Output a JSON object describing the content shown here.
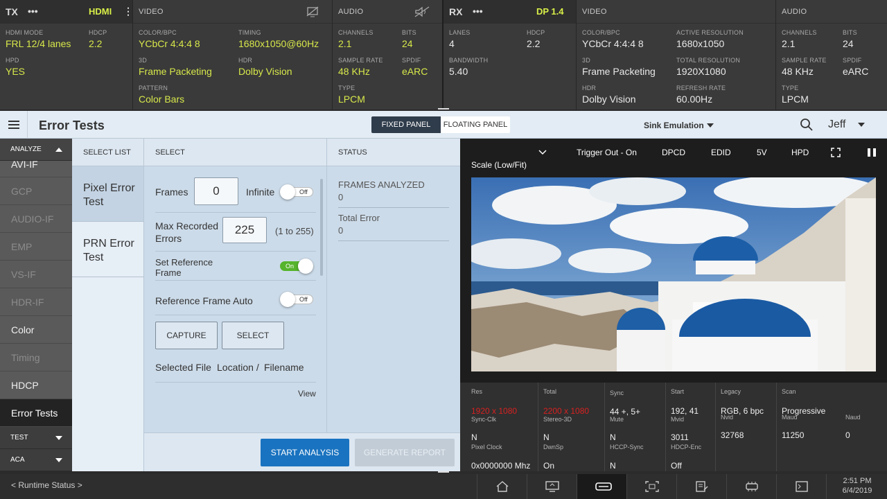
{
  "tx": {
    "label": "TX",
    "mode": "HDMI",
    "hdmi_mode_label": "HDMI MODE",
    "hdmi_mode": "FRL 12/4 lanes",
    "hdcp_label": "HDCP",
    "hdcp": "2.2",
    "hpd_label": "HPD",
    "hpd": "YES",
    "video": {
      "title": "VIDEO",
      "color_label": "COLOR/BPC",
      "color": "YCbCr  4:4:4  8",
      "timing_label": "TIMING",
      "timing": "1680x1050@60Hz",
      "3d_label": "3D",
      "3d": "Frame Packeting",
      "hdr_label": "HDR",
      "hdr": "Dolby Vision",
      "pattern_label": "PATTERN",
      "pattern": "Color Bars"
    },
    "audio": {
      "title": "AUDIO",
      "channels_label": "CHANNELS",
      "channels": "2.1",
      "bits_label": "BITS",
      "bits": "24",
      "sample_label": "SAMPLE RATE",
      "sample": "48 KHz",
      "spdif_label": "SPDIF",
      "spdif": "eARC",
      "type_label": "TYPE",
      "type": "LPCM"
    }
  },
  "rx": {
    "label": "RX",
    "mode": "DP 1.4",
    "lanes_label": "LANES",
    "lanes": "4",
    "hdcp_label": "HDCP",
    "hdcp": "2.2",
    "bw_label": "BANDWIDTH",
    "bw": "5.40",
    "video": {
      "title": "VIDEO",
      "color_label": "COLOR/BPC",
      "color": "YCbCr  4:4:4  8",
      "active_label": "ACTIVE RESOLUTION",
      "active": "1680x1050",
      "3d_label": "3D",
      "3d": "Frame Packeting",
      "total_label": "TOTAL RESOLUTION",
      "total": "1920X1080",
      "hdr_label": "HDR",
      "hdr": "Dolby Vision",
      "refresh_label": "REFRESH RATE",
      "refresh": "60.00Hz"
    },
    "audio": {
      "title": "AUDIO",
      "channels_label": "CHANNELS",
      "channels": "2.1",
      "bits_label": "BITS",
      "bits": "24",
      "sample_label": "SAMPLE RATE",
      "sample": "48 KHz",
      "spdif_label": "SPDIF",
      "spdif": "eARC",
      "type_label": "TYPE",
      "type": "LPCM"
    }
  },
  "header": {
    "title": "Error Tests",
    "fixed_panel": "FIXED PANEL",
    "floating_panel": "FLOATING PANEL",
    "mode_select": "Sink Emulation",
    "user": "Jeff"
  },
  "sidebar": {
    "analyze": "ANALYZE",
    "items": [
      {
        "label": "AVI-IF"
      },
      {
        "label": "GCP"
      },
      {
        "label": "AUDIO-IF"
      },
      {
        "label": "EMP"
      },
      {
        "label": "VS-IF"
      },
      {
        "label": "HDR-IF"
      },
      {
        "label": "Color"
      },
      {
        "label": "Timing"
      },
      {
        "label": "HDCP"
      },
      {
        "label": "Error Tests"
      }
    ],
    "test": "TEST",
    "aca": "ACA"
  },
  "select_list": {
    "header": "SELECT LIST",
    "items": [
      "Pixel Error Test",
      "PRN Error Test"
    ]
  },
  "select": {
    "header": "SELECT",
    "frames_label": "Frames",
    "frames_value": "0",
    "infinite_label": "Infinite",
    "infinite_state": "Off",
    "max_label": "Max Recorded Errors",
    "max_value": "225",
    "max_range": "(1 to 255)",
    "setref_label": "Set Reference Frame",
    "setref_state": "On",
    "refauto_label": "Reference Frame Auto",
    "refauto_state": "Off",
    "capture": "CAPTURE",
    "select_btn": "SELECT",
    "selected_file_label": "Selected File",
    "selected_file_loc": "Location / ",
    "selected_file_name": "Filename",
    "view": "View"
  },
  "status": {
    "header": "STATUS",
    "frames_label": "FRAMES ANALYZED",
    "frames_value": "0",
    "total_label": "Total Error",
    "total_value": "0"
  },
  "actions": {
    "start": "START ANALYSIS",
    "report": "GENERATE REPORT"
  },
  "preview": {
    "trigger": "Trigger Out - On",
    "dpcd": "DPCD",
    "edid": "EDID",
    "v5": "5V",
    "hpd": "HPD",
    "scale": "Scale (Low/Fit)"
  },
  "info": {
    "res_label": "Res",
    "res": "1920 x 1080",
    "total_label": "Total",
    "total": "2200 x 1080",
    "sync_label": "Sync",
    "sync": "44 +, 5+",
    "start_label": "Start",
    "start": "192, 41",
    "legacy_label": "Legacy",
    "legacy": "RGB, 6 bpc",
    "scan_label": "Scan",
    "scan": "Progressive",
    "syncclk_label": "Sync-Clk",
    "syncclk": "N",
    "stereo_label": "Stereo-3D",
    "stereo": "N",
    "mute_label": "Mute",
    "mute": "N",
    "mvid_label": "Mvid",
    "mvid": "3011",
    "nvid_label": "Nvid",
    "nvid": "32768",
    "maud_label": "Maud",
    "maud": "11250",
    "naud_label": "Naud",
    "naud": "0",
    "pclk_label": "Pixel Clock",
    "pclk": "0x0000000 Mhz",
    "dwnsp_label": "DwnSp",
    "dwnsp": "On",
    "hccp_label": "HCCP-Sync",
    "hccp": "N",
    "hdcpenc_label": "HDCP-Enc",
    "hdcpenc": "Off"
  },
  "bottom": {
    "runtime": "< Runtime Status >",
    "time": "2:51 PM",
    "date": "6/4/2019"
  },
  "colors": {
    "accent": "#d9ef47",
    "primary_button": "#1a73c0",
    "error": "#d92020"
  }
}
